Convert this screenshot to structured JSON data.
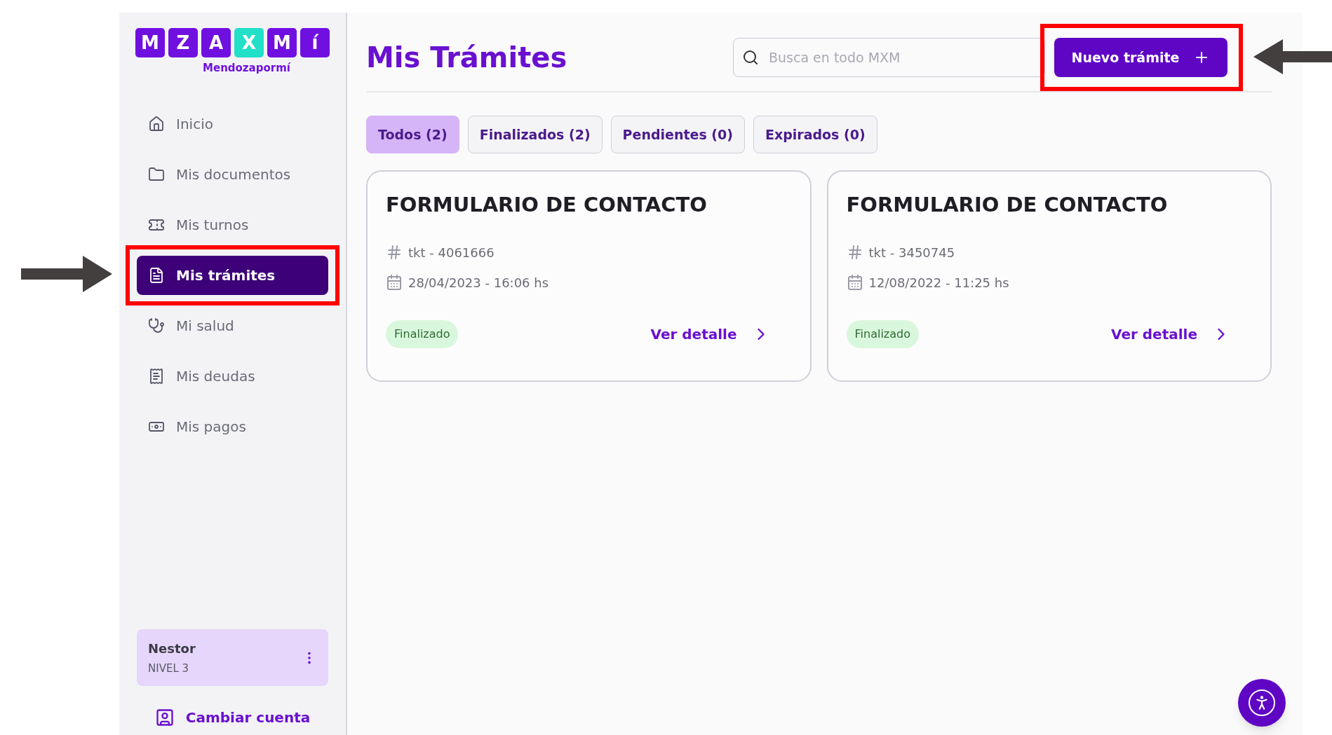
{
  "logo": {
    "tiles": [
      {
        "letter": "M",
        "color": "#7010e0"
      },
      {
        "letter": "Z",
        "color": "#7010e0"
      },
      {
        "letter": "A",
        "color": "#7010e0"
      },
      {
        "letter": "X",
        "color": "#22dfc8"
      },
      {
        "letter": "M",
        "color": "#7010e0"
      },
      {
        "letter": "í",
        "color": "#7010e0"
      }
    ],
    "tagline": "Mendozapormí"
  },
  "sidebar": {
    "items": [
      {
        "label": "Inicio",
        "selected": false
      },
      {
        "label": "Mis documentos",
        "selected": false
      },
      {
        "label": "Mis turnos",
        "selected": false
      },
      {
        "label": "Mis trámites",
        "selected": true
      },
      {
        "label": "Mi salud",
        "selected": false
      },
      {
        "label": "Mis deudas",
        "selected": false
      },
      {
        "label": "Mis pagos",
        "selected": false
      }
    ],
    "user": {
      "name": "Nestor",
      "level": "NIVEL 3"
    },
    "switch_account": "Cambiar cuenta"
  },
  "header": {
    "title": "Mis Trámites",
    "search": {
      "placeholder": "Busca en todo MXM"
    },
    "new_button": "Nuevo trámite"
  },
  "tabs": [
    {
      "label": "Todos (2)",
      "selected": true
    },
    {
      "label": "Finalizados (2)",
      "selected": false
    },
    {
      "label": "Pendientes (0)",
      "selected": false
    },
    {
      "label": "Expirados (0)",
      "selected": false
    }
  ],
  "cards": [
    {
      "title": "FORMULARIO DE CONTACTO",
      "ticket": "tkt - 4061666",
      "date": "28/04/2023 - 16:06 hs",
      "status": "Finalizado",
      "link": "Ver detalle"
    },
    {
      "title": "FORMULARIO DE CONTACTO",
      "ticket": "tkt - 3450745",
      "date": "12/08/2022 - 11:25 hs",
      "status": "Finalizado",
      "link": "Ver detalle"
    }
  ]
}
